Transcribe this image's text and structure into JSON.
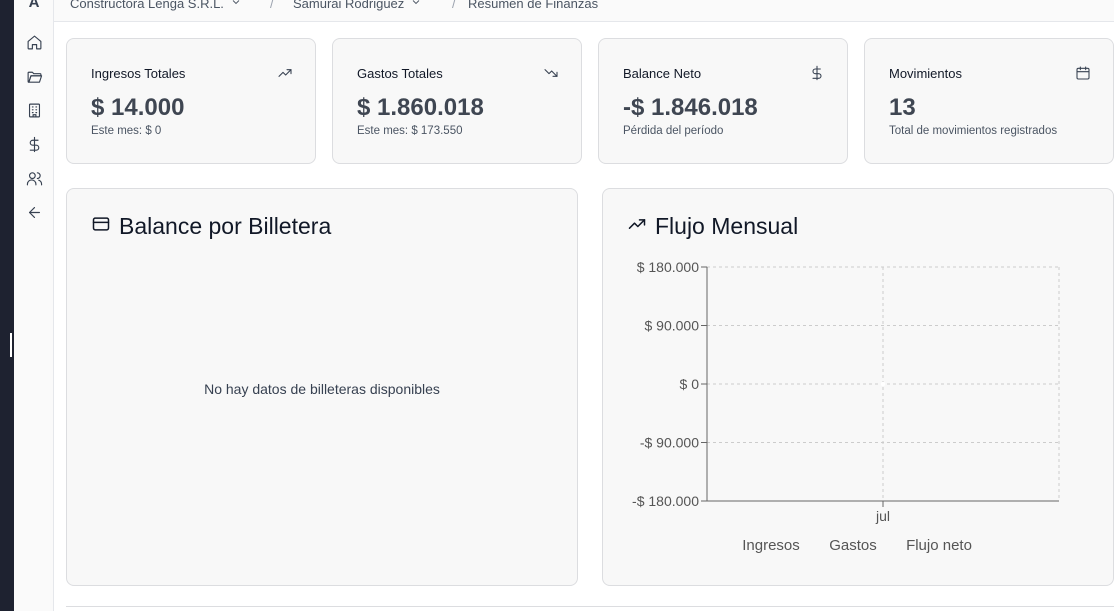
{
  "app": {
    "logo": "A"
  },
  "sidebar": {
    "items": [
      {
        "name": "home-icon"
      },
      {
        "name": "folder-icon"
      },
      {
        "name": "building-icon"
      },
      {
        "name": "dollar-icon"
      },
      {
        "name": "users-icon"
      },
      {
        "name": "arrow-left-icon"
      }
    ]
  },
  "breadcrumb": {
    "company": "Constructora Lenga S.R.L.",
    "person": "Samurai Rodriguez",
    "page": "Resumen de Finanzas",
    "separator": "/"
  },
  "stats": [
    {
      "label": "Ingresos Totales",
      "value": "$ 14.000",
      "sub": "Este mes: $ 0",
      "icon": "trending-up-icon"
    },
    {
      "label": "Gastos Totales",
      "value": "$ 1.860.018",
      "sub": "Este mes: $ 173.550",
      "icon": "trending-down-icon"
    },
    {
      "label": "Balance Neto",
      "value": "-$ 1.846.018",
      "sub": "Pérdida del período",
      "icon": "dollar-icon"
    },
    {
      "label": "Movimientos",
      "value": "13",
      "sub": "Total de movimientos registrados",
      "icon": "calendar-icon"
    }
  ],
  "wallet_panel": {
    "title": "Balance por Billetera",
    "empty_message": "No hay datos de billeteras disponibles"
  },
  "flow_panel": {
    "title": "Flujo Mensual"
  },
  "chart_data": {
    "type": "line",
    "title": "Flujo Mensual",
    "categories": [
      "jul"
    ],
    "series": [
      {
        "name": "Ingresos",
        "values": [
          0
        ]
      },
      {
        "name": "Gastos",
        "values": [
          0
        ]
      },
      {
        "name": "Flujo neto",
        "values": [
          0
        ]
      }
    ],
    "ylim": [
      -180000,
      180000
    ],
    "yticks": [
      180000,
      90000,
      0,
      -90000,
      -180000
    ],
    "ytick_labels": [
      "$ 180.000",
      "$ 90.000",
      "$ 0",
      "-$ 90.000",
      "-$ 180.000"
    ],
    "grid": true,
    "legend": "bottom",
    "colors": {
      "grid": "#cccccc",
      "axis": "#666666",
      "text": "#555555"
    }
  }
}
